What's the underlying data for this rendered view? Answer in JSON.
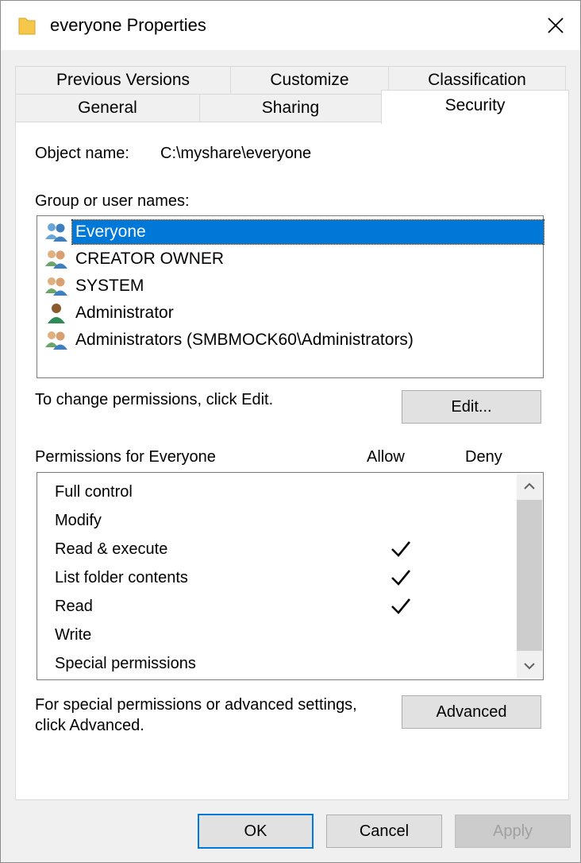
{
  "window": {
    "title": "everyone Properties",
    "close_glyph": "✕"
  },
  "tabs": {
    "row1": [
      {
        "label": "Previous Versions"
      },
      {
        "label": "Customize"
      },
      {
        "label": "Classification"
      }
    ],
    "row2": [
      {
        "label": "General"
      },
      {
        "label": "Sharing"
      },
      {
        "label": "Security"
      }
    ],
    "active": "Security"
  },
  "security": {
    "object_name_label": "Object name:",
    "object_name_value": "C:\\myshare\\everyone",
    "group_label": "Group or user names:",
    "users": [
      {
        "name": "Everyone",
        "icon": "group-icon",
        "selected": true
      },
      {
        "name": "CREATOR OWNER",
        "icon": "group-icon"
      },
      {
        "name": "SYSTEM",
        "icon": "group-icon"
      },
      {
        "name": "Administrator",
        "icon": "user-icon"
      },
      {
        "name": "Administrators (SMBMOCK60\\Administrators)",
        "icon": "group-icon"
      }
    ],
    "change_text": "To change permissions, click Edit.",
    "edit_button": "Edit...",
    "permissions_label": "Permissions for Everyone",
    "allow_header": "Allow",
    "deny_header": "Deny",
    "permissions": [
      {
        "name": "Full control",
        "allow": false,
        "deny": false
      },
      {
        "name": "Modify",
        "allow": false,
        "deny": false
      },
      {
        "name": "Read & execute",
        "allow": true,
        "deny": false
      },
      {
        "name": "List folder contents",
        "allow": true,
        "deny": false
      },
      {
        "name": "Read",
        "allow": true,
        "deny": false
      },
      {
        "name": "Write",
        "allow": false,
        "deny": false
      },
      {
        "name": "Special permissions",
        "allow": false,
        "deny": false
      }
    ],
    "advanced_text_line1": "For special permissions or advanced settings,",
    "advanced_text_line2": "click Advanced.",
    "advanced_button": "Advanced"
  },
  "footer": {
    "ok": "OK",
    "cancel": "Cancel",
    "apply": "Apply"
  },
  "colors": {
    "selection": "#0078d7",
    "dialog_bg": "#f0f0f0",
    "folder": "#f5c84c"
  }
}
